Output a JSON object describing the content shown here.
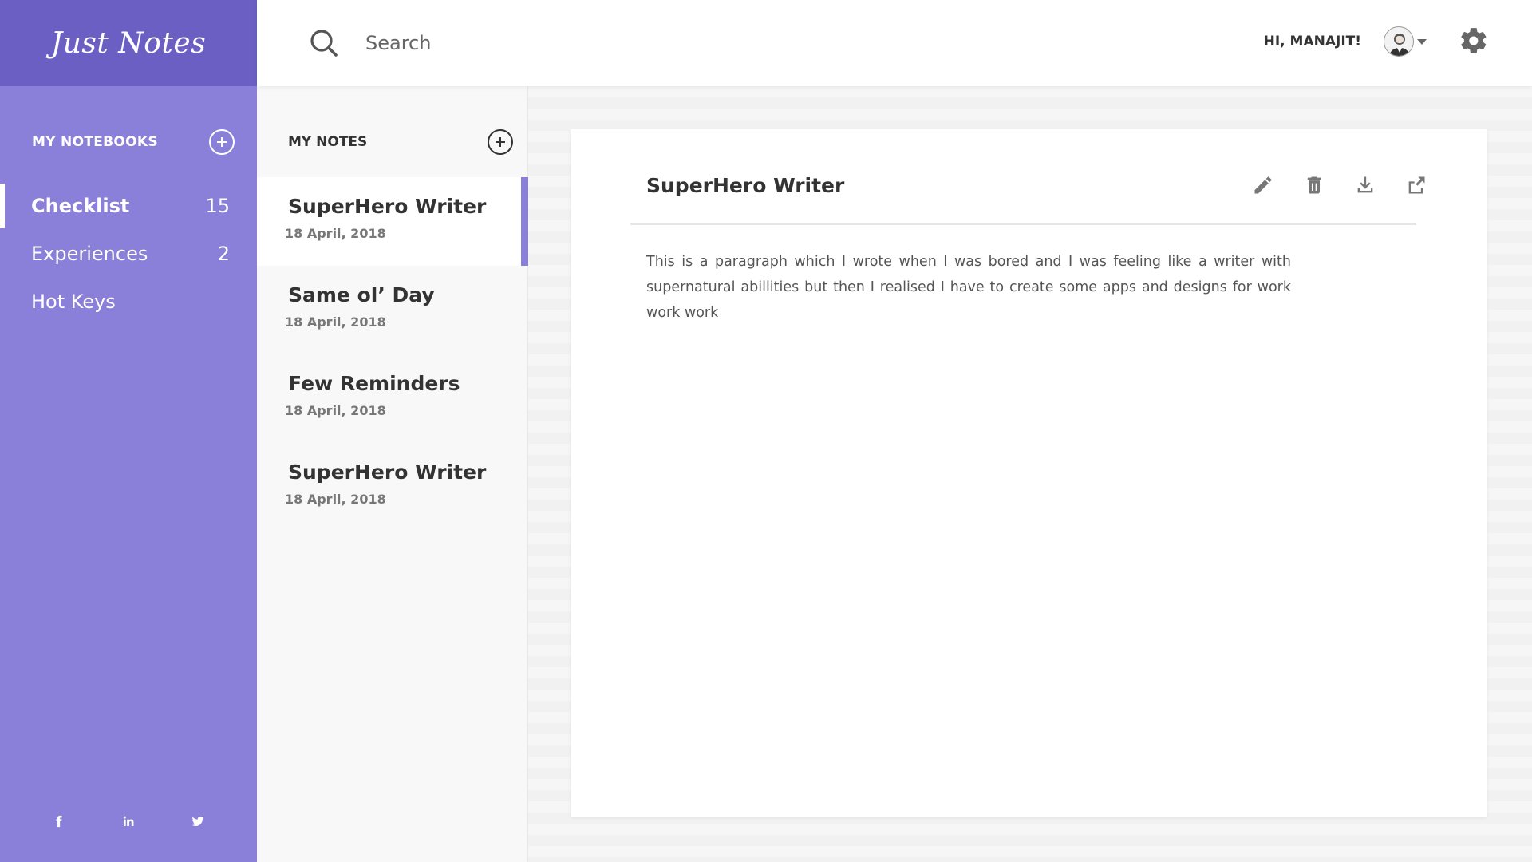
{
  "app": {
    "logo": "Just Notes"
  },
  "sidebar": {
    "header_label": "MY NOTEBOOKS",
    "notebooks": [
      {
        "label": "Checklist",
        "count": "15",
        "active": true
      },
      {
        "label": "Experiences",
        "count": "2"
      },
      {
        "label": "Hot Keys",
        "count": ""
      }
    ],
    "social": [
      "facebook-icon",
      "linkedin-icon",
      "twitter-icon"
    ]
  },
  "header": {
    "search_placeholder": "Search",
    "greeting": "HI, MANAJIT!"
  },
  "notes": {
    "header_label": "MY NOTES",
    "items": [
      {
        "title": "SuperHero Writer",
        "date": "18 April, 2018",
        "active": true
      },
      {
        "title": "Same ol’ Day",
        "date": "18 April, 2018"
      },
      {
        "title": "Few Reminders",
        "date": "18 April, 2018"
      },
      {
        "title": "SuperHero Writer",
        "date": "18 April, 2018"
      }
    ]
  },
  "note_view": {
    "title": "SuperHero Writer",
    "body": "This is a paragraph which I wrote when I was bored and I was feeling like a writer with supernatural abillities  but then I realised I have to create some apps and designs for work work work"
  },
  "colors": {
    "accent": "#8b80d9",
    "accent_dark": "#6b5fc4"
  }
}
